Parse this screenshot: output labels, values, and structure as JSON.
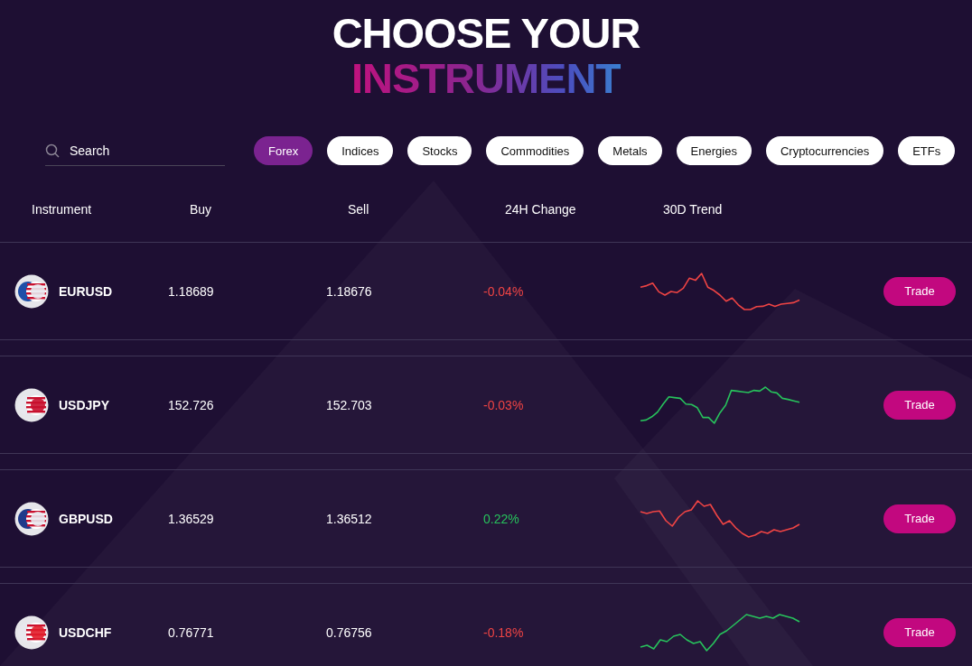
{
  "title": {
    "line_1": "CHOOSE YOUR",
    "line_2": "INSTRUMENT"
  },
  "search": {
    "placeholder": "Search"
  },
  "categories": [
    {
      "label": "Forex",
      "selected": true
    },
    {
      "label": "Indices",
      "selected": false
    },
    {
      "label": "Stocks",
      "selected": false
    },
    {
      "label": "Commodities",
      "selected": false
    },
    {
      "label": "Metals",
      "selected": false
    },
    {
      "label": "Energies",
      "selected": false
    },
    {
      "label": "Cryptocurrencies",
      "selected": false
    },
    {
      "label": "ETFs",
      "selected": false
    }
  ],
  "table": {
    "columns": [
      "Instrument",
      "Buy",
      "Sell",
      "24H Change",
      "30D Trend"
    ],
    "rows": [
      {
        "instrument": "EURUSD",
        "buy": "1.18689",
        "sell": "1.18676",
        "change": "-0.04%",
        "change_negative": true,
        "trend_rising": false,
        "action": "Trade"
      },
      {
        "instrument": "USDJPY",
        "buy": "152.726",
        "sell": "152.703",
        "change": "-0.03%",
        "change_negative": true,
        "trend_rising": true,
        "action": "Trade"
      },
      {
        "instrument": "GBPUSD",
        "buy": "1.36529",
        "sell": "1.36512",
        "change": "0.22%",
        "change_negative": false,
        "trend_rising": false,
        "action": "Trade"
      },
      {
        "instrument": "USDCHF",
        "buy": "0.76771",
        "sell": "0.76756",
        "change": "-0.18%",
        "change_negative": true,
        "trend_rising": true,
        "action": "Trade"
      }
    ]
  }
}
